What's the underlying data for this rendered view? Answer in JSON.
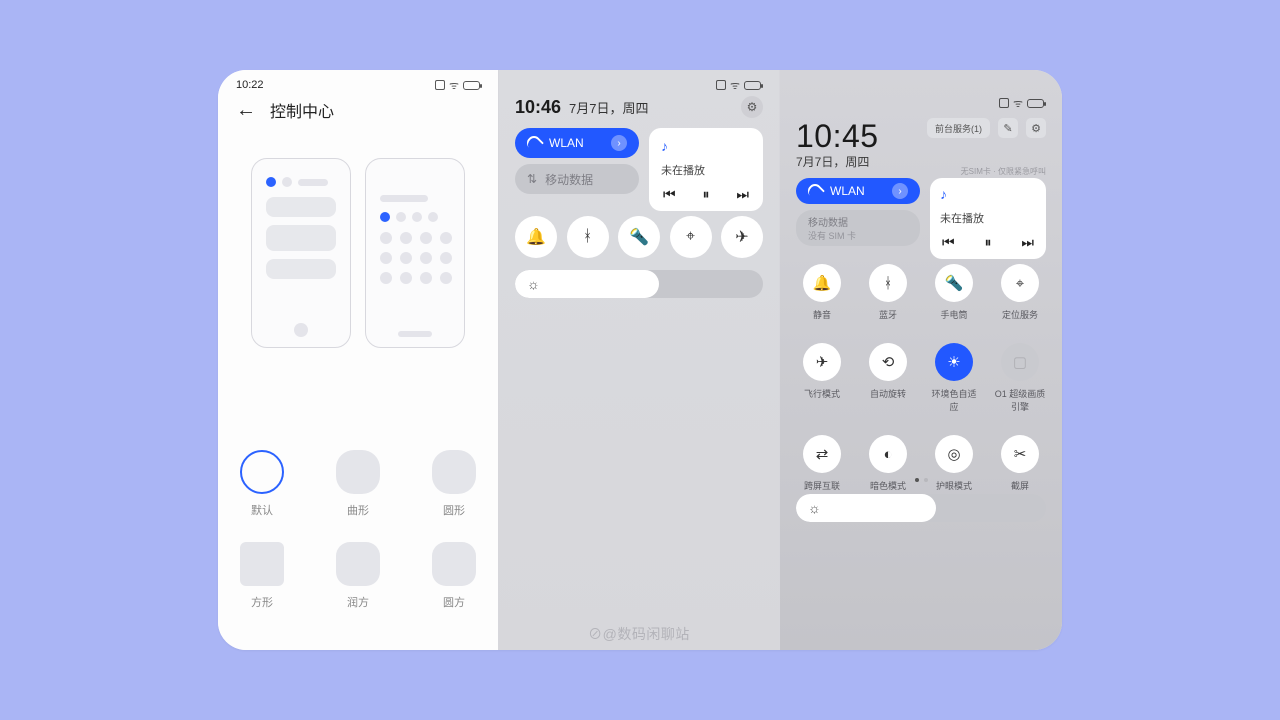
{
  "panel1": {
    "status_time": "10:22",
    "title": "控制中心",
    "shapes": [
      {
        "label": "默认"
      },
      {
        "label": "曲形"
      },
      {
        "label": "圆形"
      },
      {
        "label": "方形"
      },
      {
        "label": "润方"
      },
      {
        "label": "圆方"
      }
    ]
  },
  "panel2": {
    "time": "10:46",
    "date": "7月7日，周四",
    "wlan_label": "WLAN",
    "data_label": "移动数据",
    "media_text": "未在播放",
    "watermark": "⊘@数码闲聊站"
  },
  "panel3": {
    "time": "10:45",
    "date": "7月7日，周四",
    "chip": "前台服务(1)",
    "sub": "无SIM卡 · 仅限紧急呼叫",
    "wlan_label": "WLAN",
    "data_label": "移动数据",
    "data_sub": "没有 SIM 卡",
    "media_text": "未在播放",
    "toggles": [
      {
        "icon": "🔔",
        "label": "静音"
      },
      {
        "icon": "ᚼ",
        "label": "蓝牙"
      },
      {
        "icon": "🔦",
        "label": "手电筒"
      },
      {
        "icon": "⌖",
        "label": "定位服务"
      },
      {
        "icon": "✈",
        "label": "飞行模式"
      },
      {
        "icon": "⟲",
        "label": "自动旋转"
      },
      {
        "icon": "☀",
        "label": "环境色自适应",
        "on": true
      },
      {
        "icon": "▢",
        "label": "O1 超级画质引擎",
        "off": true
      },
      {
        "icon": "⇄",
        "label": "跨屏互联"
      },
      {
        "icon": "◐",
        "label": "暗色模式"
      },
      {
        "icon": "◎",
        "label": "护眼模式"
      },
      {
        "icon": "✂",
        "label": "截屏"
      }
    ]
  }
}
